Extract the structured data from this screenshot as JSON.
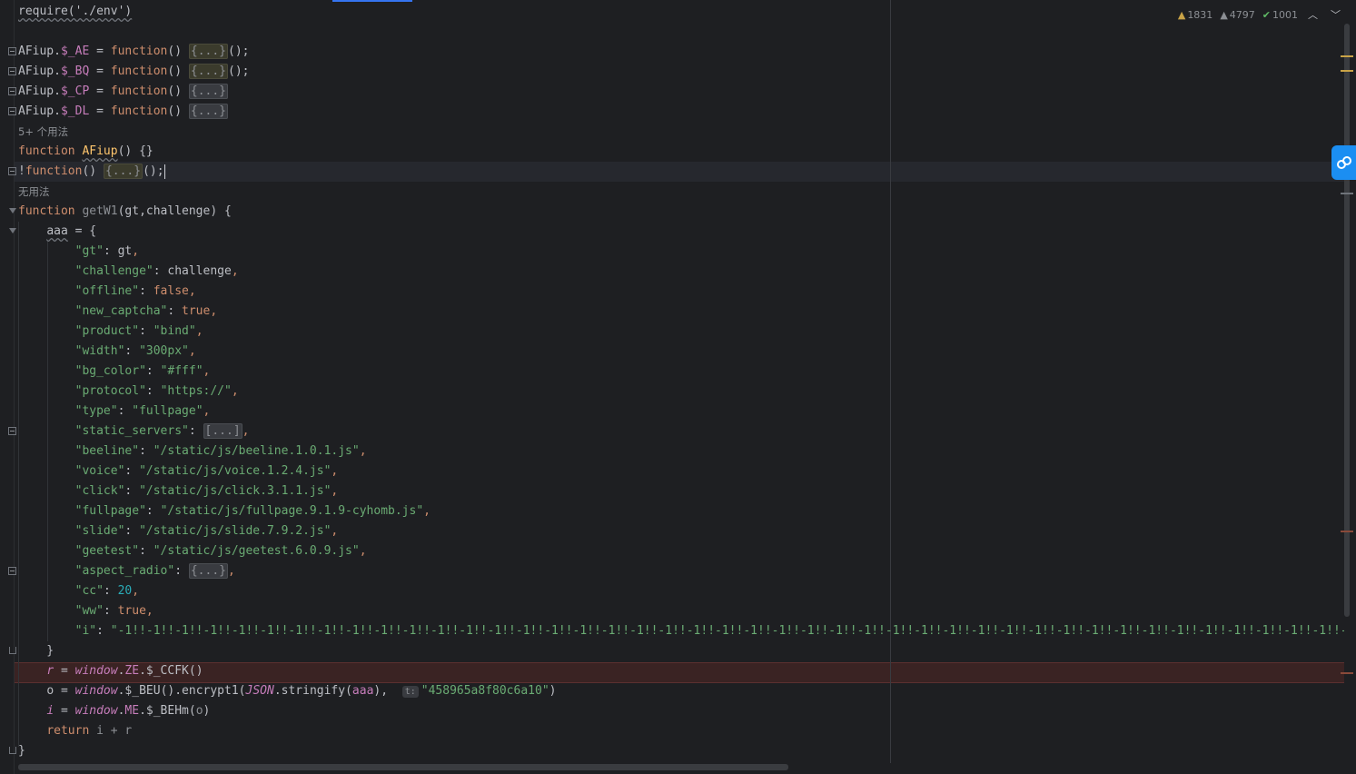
{
  "inspections": {
    "warnings": "1831",
    "weak_warnings": "4797",
    "ok": "1001"
  },
  "hints": {
    "usages_5": "5+ 个用法",
    "no_usages": "无用法"
  },
  "code": {
    "l_require": "require('./env')",
    "ae_obj": "AFiup",
    "ae_prop": "$_AE",
    "bq_obj": "AFiup",
    "bq_prop": "$_BQ",
    "cp_obj": "AFiup",
    "cp_prop": "$_CP",
    "dl_obj": "AFiup",
    "dl_prop": "$_DL",
    "fn_kw": "function",
    "afiup_name": "AFiup",
    "folded": "{...}",
    "folded_arr": "[...]",
    "getw1_name": "getW1",
    "getw1_params": "(gt,challenge) {",
    "aaa": "aaa",
    "entries": [
      {
        "k": "\"gt\"",
        "v": "gt",
        "type": "id"
      },
      {
        "k": "\"challenge\"",
        "v": "challenge",
        "type": "id"
      },
      {
        "k": "\"offline\"",
        "v": "false",
        "type": "kw"
      },
      {
        "k": "\"new_captcha\"",
        "v": "true",
        "type": "kw"
      },
      {
        "k": "\"product\"",
        "v": "\"bind\"",
        "type": "str"
      },
      {
        "k": "\"width\"",
        "v": "\"300px\"",
        "type": "str"
      },
      {
        "k": "\"bg_color\"",
        "v": "\"#fff\"",
        "type": "str"
      },
      {
        "k": "\"protocol\"",
        "v": "\"https://\"",
        "type": "str"
      },
      {
        "k": "\"type\"",
        "v": "\"fullpage\"",
        "type": "str"
      },
      {
        "k": "\"static_servers\"",
        "v": "[...]",
        "type": "fold"
      },
      {
        "k": "\"beeline\"",
        "v": "\"/static/js/beeline.1.0.1.js\"",
        "type": "str"
      },
      {
        "k": "\"voice\"",
        "v": "\"/static/js/voice.1.2.4.js\"",
        "type": "str"
      },
      {
        "k": "\"click\"",
        "v": "\"/static/js/click.3.1.1.js\"",
        "type": "str"
      },
      {
        "k": "\"fullpage\"",
        "v": "\"/static/js/fullpage.9.1.9-cyhomb.js\"",
        "type": "str"
      },
      {
        "k": "\"slide\"",
        "v": "\"/static/js/slide.7.9.2.js\"",
        "type": "str"
      },
      {
        "k": "\"geetest\"",
        "v": "\"/static/js/geetest.6.0.9.js\"",
        "type": "str"
      },
      {
        "k": "\"aspect_radio\"",
        "v": "{...}",
        "type": "fold"
      },
      {
        "k": "\"cc\"",
        "v": "20",
        "type": "num"
      },
      {
        "k": "\"ww\"",
        "v": "true",
        "type": "kw"
      },
      {
        "k": "\"i\"",
        "v": "\"-1!!-1!!-1!!-1!!-1!!-1!!-1!!-1!!-1!!-1!!-1!!-1!!-1!!-1!!-1!!-1!!-1!!-1!!-1!!-1!!-1!!-1!!-1!!-1!!-1!!-1!!-1!!-1!!-1!!-1!!-1!!-1!!-1!!-1!!-1!!-1!!-1!!-1!!-1!!-1!!-1!!-1!!-1!!-1!!-1!!-1!!-1!!-1",
        "type": "str"
      }
    ],
    "r_var": "r",
    "window": "window",
    "ze": "ZE",
    "ccfk": "$_CCFK",
    "o_var": "o",
    "beu": "$_BEU",
    "encrypt": "encrypt1",
    "json": "JSON",
    "stringify": "stringify",
    "hint_t": "t:",
    "key_str": "\"458965a8f80c6a10\"",
    "i_var": "i",
    "me": "ME",
    "behm": "$_BEHm",
    "ret": "return",
    "ret_expr": "i + r"
  }
}
